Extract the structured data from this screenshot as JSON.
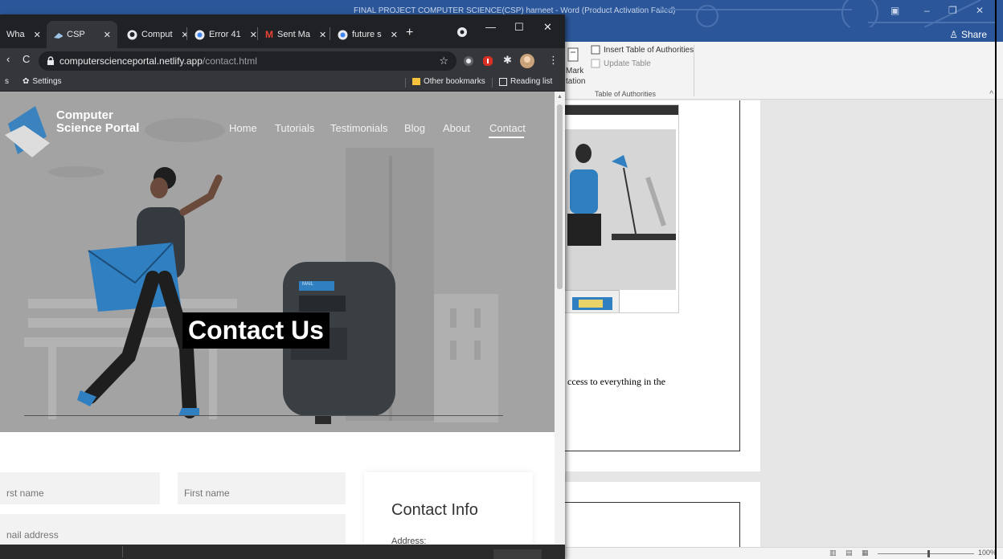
{
  "word": {
    "title": "FINAL PROJECT COMPUTER SCIENCE(CSP) harneet - Word (Product Activation Failed)",
    "share_label": "Share",
    "ribbon": {
      "insert_toa": "Insert Table of Authorities",
      "update_table": "Update Table",
      "mark_citation_1": "Mark",
      "mark_citation_2": "tation",
      "group_label": "Table of Authorities"
    },
    "doc_text": "ccess to everything in the",
    "zoom": "100%"
  },
  "chrome": {
    "tabs": [
      {
        "label": "Wha",
        "icon": "whatsapp-icon"
      },
      {
        "label": "CSP",
        "icon": "csp-logo-icon",
        "active": true
      },
      {
        "label": "Comput",
        "icon": "github-icon"
      },
      {
        "label": "Error 41",
        "icon": "google-icon"
      },
      {
        "label": "Sent Ma",
        "icon": "gmail-icon"
      },
      {
        "label": "future s",
        "icon": "google-icon"
      }
    ],
    "url_host": "computerscienceportal.netlify.app",
    "url_path": "/contact.html",
    "bookmarks": {
      "settings": "Settings",
      "other": "Other bookmarks",
      "reading_list": "Reading list"
    }
  },
  "site": {
    "brand_line1": "Computer",
    "brand_line2": "Science Portal",
    "nav": [
      "Home",
      "Tutorials",
      "Testimonials",
      "Blog",
      "About",
      "Contact"
    ],
    "active_nav": "Contact",
    "hero_title": "Contact Us",
    "mailbox_label": "MAIL",
    "form": {
      "first_name_placeholder_a": "rst name",
      "first_name_placeholder_b": "First name",
      "email_placeholder": "nail address"
    },
    "info": {
      "title": "Contact Info",
      "address_label": "Address:"
    }
  },
  "colors": {
    "word_blue": "#2b579a",
    "chrome_dark": "#202124",
    "chrome_toolbar": "#35363a",
    "hero_gray": "#a3a3a3",
    "envelope_blue": "#2f7fc1"
  }
}
